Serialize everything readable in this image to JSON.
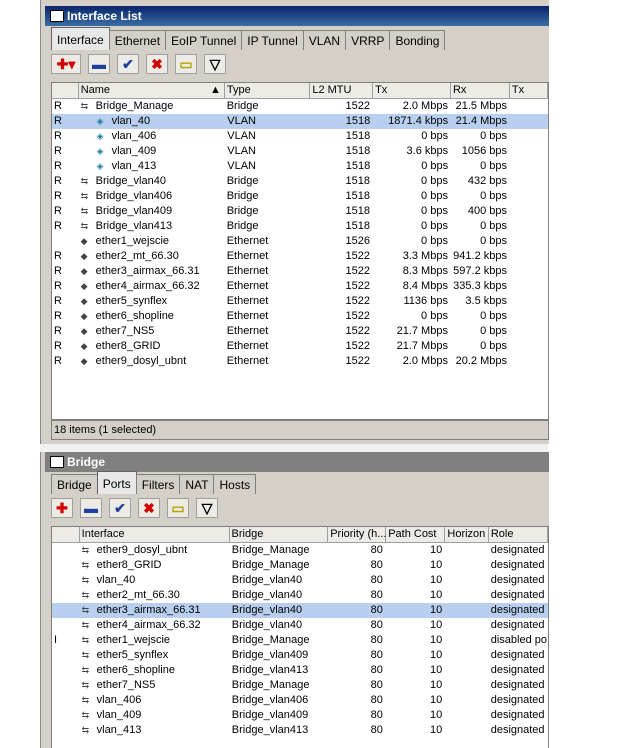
{
  "interface_window": {
    "title": "Interface List",
    "tabs": [
      "Interface",
      "Ethernet",
      "EoIP Tunnel",
      "IP Tunnel",
      "VLAN",
      "VRRP",
      "Bonding"
    ],
    "columns": [
      "Name",
      "Type",
      "L2 MTU",
      "Tx",
      "Rx",
      "Tx"
    ],
    "rows": [
      {
        "flag": "R",
        "name": "Bridge_Manage",
        "type": "Bridge",
        "mtu": "1522",
        "tx": "2.0 Mbps",
        "rx": "21.5 Mbps",
        "icon": "bridge-icon",
        "indent": false,
        "selected": false
      },
      {
        "flag": "R",
        "name": "vlan_40",
        "type": "VLAN",
        "mtu": "1518",
        "tx": "1871.4 kbps",
        "rx": "21.4 Mbps",
        "icon": "vlan-icon",
        "indent": true,
        "selected": true
      },
      {
        "flag": "R",
        "name": "vlan_406",
        "type": "VLAN",
        "mtu": "1518",
        "tx": "0 bps",
        "rx": "0 bps",
        "icon": "vlan-icon",
        "indent": true,
        "selected": false
      },
      {
        "flag": "R",
        "name": "vlan_409",
        "type": "VLAN",
        "mtu": "1518",
        "tx": "3.6 kbps",
        "rx": "1056 bps",
        "icon": "vlan-icon",
        "indent": true,
        "selected": false
      },
      {
        "flag": "R",
        "name": "vlan_413",
        "type": "VLAN",
        "mtu": "1518",
        "tx": "0 bps",
        "rx": "0 bps",
        "icon": "vlan-icon",
        "indent": true,
        "selected": false
      },
      {
        "flag": "R",
        "name": "Bridge_vlan40",
        "type": "Bridge",
        "mtu": "1518",
        "tx": "0 bps",
        "rx": "432 bps",
        "icon": "bridge-icon",
        "indent": false,
        "selected": false
      },
      {
        "flag": "R",
        "name": "Bridge_vlan406",
        "type": "Bridge",
        "mtu": "1518",
        "tx": "0 bps",
        "rx": "0 bps",
        "icon": "bridge-icon",
        "indent": false,
        "selected": false
      },
      {
        "flag": "R",
        "name": "Bridge_vlan409",
        "type": "Bridge",
        "mtu": "1518",
        "tx": "0 bps",
        "rx": "400 bps",
        "icon": "bridge-icon",
        "indent": false,
        "selected": false
      },
      {
        "flag": "R",
        "name": "Bridge_vlan413",
        "type": "Bridge",
        "mtu": "1518",
        "tx": "0 bps",
        "rx": "0 bps",
        "icon": "bridge-icon",
        "indent": false,
        "selected": false
      },
      {
        "flag": "",
        "name": "ether1_wejscie",
        "type": "Ethernet",
        "mtu": "1526",
        "tx": "0 bps",
        "rx": "0 bps",
        "icon": "ethernet-icon",
        "indent": false,
        "selected": false
      },
      {
        "flag": "R",
        "name": "ether2_mt_66.30",
        "type": "Ethernet",
        "mtu": "1522",
        "tx": "3.3 Mbps",
        "rx": "941.2 kbps",
        "icon": "ethernet-icon",
        "indent": false,
        "selected": false
      },
      {
        "flag": "R",
        "name": "ether3_airmax_66.31",
        "type": "Ethernet",
        "mtu": "1522",
        "tx": "8.3 Mbps",
        "rx": "597.2 kbps",
        "icon": "ethernet-icon",
        "indent": false,
        "selected": false
      },
      {
        "flag": "R",
        "name": "ether4_airmax_66.32",
        "type": "Ethernet",
        "mtu": "1522",
        "tx": "8.4 Mbps",
        "rx": "335.3 kbps",
        "icon": "ethernet-icon",
        "indent": false,
        "selected": false
      },
      {
        "flag": "R",
        "name": "ether5_synflex",
        "type": "Ethernet",
        "mtu": "1522",
        "tx": "1136 bps",
        "rx": "3.5 kbps",
        "icon": "ethernet-icon",
        "indent": false,
        "selected": false
      },
      {
        "flag": "R",
        "name": "ether6_shopline",
        "type": "Ethernet",
        "mtu": "1522",
        "tx": "0 bps",
        "rx": "0 bps",
        "icon": "ethernet-icon",
        "indent": false,
        "selected": false
      },
      {
        "flag": "R",
        "name": "ether7_NS5",
        "type": "Ethernet",
        "mtu": "1522",
        "tx": "21.7 Mbps",
        "rx": "0 bps",
        "icon": "ethernet-icon",
        "indent": false,
        "selected": false
      },
      {
        "flag": "R",
        "name": "ether8_GRID",
        "type": "Ethernet",
        "mtu": "1522",
        "tx": "21.7 Mbps",
        "rx": "0 bps",
        "icon": "ethernet-icon",
        "indent": false,
        "selected": false
      },
      {
        "flag": "R",
        "name": "ether9_dosyl_ubnt",
        "type": "Ethernet",
        "mtu": "1522",
        "tx": "2.0 Mbps",
        "rx": "20.2 Mbps",
        "icon": "ethernet-icon",
        "indent": false,
        "selected": false
      }
    ],
    "status": "18 items (1 selected)"
  },
  "bridge_window": {
    "title": "Bridge",
    "tabs": [
      "Bridge",
      "Ports",
      "Filters",
      "NAT",
      "Hosts"
    ],
    "columns": [
      "Interface",
      "Bridge",
      "Priority (h...",
      "Path Cost",
      "Horizon",
      "Role"
    ],
    "rows": [
      {
        "flag": "",
        "iface": "ether9_dosyl_ubnt",
        "bridge": "Bridge_Manage",
        "prio": "80",
        "cost": "10",
        "horizon": "",
        "role": "designated",
        "selected": false
      },
      {
        "flag": "",
        "iface": "ether8_GRID",
        "bridge": "Bridge_Manage",
        "prio": "80",
        "cost": "10",
        "horizon": "",
        "role": "designated",
        "selected": false
      },
      {
        "flag": "",
        "iface": "vlan_40",
        "bridge": "Bridge_vlan40",
        "prio": "80",
        "cost": "10",
        "horizon": "",
        "role": "designated",
        "selected": false
      },
      {
        "flag": "",
        "iface": "ether2_mt_66.30",
        "bridge": "Bridge_vlan40",
        "prio": "80",
        "cost": "10",
        "horizon": "",
        "role": "designated",
        "selected": false
      },
      {
        "flag": "",
        "iface": "ether3_airmax_66.31",
        "bridge": "Bridge_vlan40",
        "prio": "80",
        "cost": "10",
        "horizon": "",
        "role": "designated",
        "selected": true
      },
      {
        "flag": "",
        "iface": "ether4_airmax_66.32",
        "bridge": "Bridge_vlan40",
        "prio": "80",
        "cost": "10",
        "horizon": "",
        "role": "designated",
        "selected": false
      },
      {
        "flag": "I",
        "iface": "ether1_wejscie",
        "bridge": "Bridge_Manage",
        "prio": "80",
        "cost": "10",
        "horizon": "",
        "role": "disabled po",
        "selected": false
      },
      {
        "flag": "",
        "iface": "ether5_synflex",
        "bridge": "Bridge_vlan409",
        "prio": "80",
        "cost": "10",
        "horizon": "",
        "role": "designated",
        "selected": false
      },
      {
        "flag": "",
        "iface": "ether6_shopline",
        "bridge": "Bridge_vlan413",
        "prio": "80",
        "cost": "10",
        "horizon": "",
        "role": "designated",
        "selected": false
      },
      {
        "flag": "",
        "iface": "ether7_NS5",
        "bridge": "Bridge_Manage",
        "prio": "80",
        "cost": "10",
        "horizon": "",
        "role": "designated",
        "selected": false
      },
      {
        "flag": "",
        "iface": "vlan_406",
        "bridge": "Bridge_vlan406",
        "prio": "80",
        "cost": "10",
        "horizon": "",
        "role": "designated",
        "selected": false
      },
      {
        "flag": "",
        "iface": "vlan_409",
        "bridge": "Bridge_vlan409",
        "prio": "80",
        "cost": "10",
        "horizon": "",
        "role": "designated",
        "selected": false
      },
      {
        "flag": "",
        "iface": "vlan_413",
        "bridge": "Bridge_vlan413",
        "prio": "80",
        "cost": "10",
        "horizon": "",
        "role": "designated",
        "selected": false
      }
    ]
  },
  "toolbar_icons": [
    "add-icon",
    "remove-icon",
    "enable-icon",
    "disable-icon",
    "comment-icon",
    "filter-icon"
  ],
  "colors": {
    "selection": "#b8cff0",
    "titlebar_active": "#0a246a",
    "titlebar_inactive": "#808080"
  }
}
